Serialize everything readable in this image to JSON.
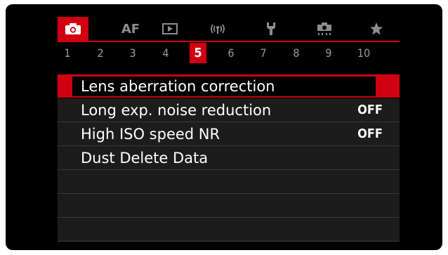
{
  "tabs": [
    {
      "id": "shooting",
      "icon": "camera-icon",
      "label": "",
      "active": true
    },
    {
      "id": "af",
      "icon": "",
      "label": "AF",
      "active": false
    },
    {
      "id": "playback",
      "icon": "playback-icon",
      "label": "",
      "active": false
    },
    {
      "id": "wireless",
      "icon": "wireless-icon",
      "label": "",
      "active": false
    },
    {
      "id": "setup",
      "icon": "wrench-icon",
      "label": "",
      "active": false
    },
    {
      "id": "custom",
      "icon": "custom-camera-icon",
      "label": "",
      "active": false
    },
    {
      "id": "mymenu",
      "icon": "star-icon",
      "label": "",
      "active": false
    }
  ],
  "pages": [
    "1",
    "2",
    "3",
    "4",
    "5",
    "6",
    "7",
    "8",
    "9",
    "10"
  ],
  "active_page": "5",
  "items": [
    {
      "label": "Lens aberration correction",
      "value": "",
      "selected": true
    },
    {
      "label": "Long exp. noise reduction",
      "value": "OFF",
      "selected": false
    },
    {
      "label": "High ISO speed NR",
      "value": "OFF",
      "selected": false
    },
    {
      "label": "Dust Delete Data",
      "value": "",
      "selected": false
    },
    {
      "label": "",
      "value": "",
      "selected": false
    },
    {
      "label": "",
      "value": "",
      "selected": false
    },
    {
      "label": "",
      "value": "",
      "selected": false
    }
  ],
  "colors": {
    "accent": "#d00010",
    "background": "#000000",
    "row": "#1c1c1c",
    "inactive_text": "#8c8c8c"
  }
}
